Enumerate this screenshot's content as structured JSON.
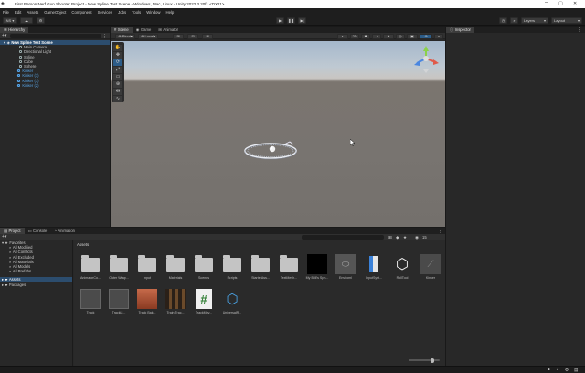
{
  "window": {
    "title": "First Person Nerf Gun Shooter Project - New Spline Test Scene - Windows, Mac, Linux - Unity 2022.3.20f1 <DX11>",
    "controls": [
      "–",
      "▢",
      "✕"
    ]
  },
  "menu": [
    "File",
    "Edit",
    "Assets",
    "GameObject",
    "Component",
    "Services",
    "Jobs",
    "Tools",
    "Window",
    "Help"
  ],
  "toolbar": {
    "account": "NS",
    "play_icon": "▶",
    "pause_icon": "❚❚",
    "step_icon": "▶|",
    "layers": "Layers",
    "layout": "Layout"
  },
  "hierarchy": {
    "tab": "Hierarchy",
    "search_placeholder": "All",
    "items": [
      {
        "label": "New Spline Test Scene",
        "indent": 0,
        "type": "root"
      },
      {
        "label": "Main Camera",
        "indent": 1,
        "type": "normal"
      },
      {
        "label": "Directional Light",
        "indent": 1,
        "type": "normal"
      },
      {
        "label": "Spline",
        "indent": 1,
        "type": "normal"
      },
      {
        "label": "Cube",
        "indent": 1,
        "type": "normal"
      },
      {
        "label": "Sphere",
        "indent": 1,
        "type": "normal"
      },
      {
        "label": "Kinker",
        "indent": 1,
        "type": "blue"
      },
      {
        "label": "Kinker (1)",
        "indent": 1,
        "type": "blue"
      },
      {
        "label": "Kinker (1)",
        "indent": 1,
        "type": "blue"
      },
      {
        "label": "Kinker (2)",
        "indent": 1,
        "type": "blue"
      }
    ]
  },
  "scene": {
    "tabs": [
      "Scene",
      "Game",
      "Animator"
    ],
    "pivot": "Pivot",
    "local": "Local",
    "mode_2d": "2D"
  },
  "inspector": {
    "tab": "Inspector"
  },
  "project": {
    "tabs": [
      "Project",
      "Console",
      "Animation"
    ],
    "favorites": {
      "label": "Favorites",
      "items": [
        "All Modified",
        "All Conflicts",
        "All Excluded",
        "All Materials",
        "All Models",
        "All Prefabs"
      ]
    },
    "roots": [
      "Assets",
      "Packages"
    ],
    "breadcrumb": "Assets",
    "count": "15",
    "row1": [
      {
        "label": "AnimatorCo...",
        "kind": "folder"
      },
      {
        "label": "Outer Wrap...",
        "kind": "folder"
      },
      {
        "label": "Input",
        "kind": "folder"
      },
      {
        "label": "Materials",
        "kind": "folder"
      },
      {
        "label": "Scenes",
        "kind": "folder"
      },
      {
        "label": "Scripts",
        "kind": "folder"
      },
      {
        "label": "StarterAss...",
        "kind": "folder"
      },
      {
        "label": "TextMesh...",
        "kind": "folder"
      },
      {
        "label": "My Brill's Sph...",
        "kind": "black"
      },
      {
        "label": "Enviroml",
        "kind": "mesh"
      },
      {
        "label": "InputSyst...",
        "kind": "input"
      },
      {
        "label": "RollTool",
        "kind": "unity"
      },
      {
        "label": "Kinker",
        "kind": "prefab"
      }
    ],
    "row2": [
      {
        "label": "Track",
        "kind": "track"
      },
      {
        "label": "TrackLi...",
        "kind": "track"
      },
      {
        "label": "Track Bak...",
        "kind": "trackred"
      },
      {
        "label": "Train Trac...",
        "kind": "traintrack"
      },
      {
        "label": "TrackMov...",
        "kind": "script"
      },
      {
        "label": "UniversalR...",
        "kind": "urp"
      }
    ]
  },
  "colors": {
    "accent": "#2c5c88",
    "sky": "#a5b8cc",
    "ground": "#787470"
  }
}
